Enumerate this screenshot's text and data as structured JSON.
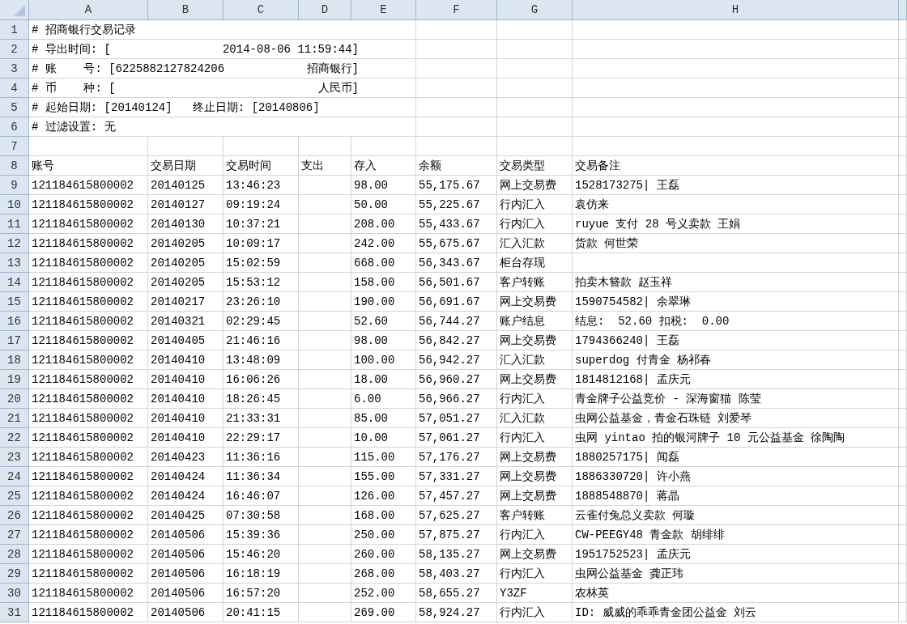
{
  "sheet": {
    "column_letters": [
      "A",
      "B",
      "C",
      "D",
      "E",
      "F",
      "G",
      "H"
    ],
    "row_numbers": [
      "1",
      "2",
      "3",
      "4",
      "5",
      "6",
      "7",
      "8",
      "9",
      "10",
      "11",
      "12",
      "13",
      "14",
      "15",
      "16",
      "17",
      "18",
      "19",
      "20",
      "21",
      "22",
      "23",
      "24",
      "25",
      "26",
      "27",
      "28",
      "29",
      "30",
      "31"
    ],
    "info_rows": [
      {
        "left": "# 招商银行交易记录"
      },
      {
        "left": "# 导出时间: [",
        "right": "2014-08-06 11:59:44]"
      },
      {
        "left": "# 账    号: [6225882127824206",
        "right": "招商银行]"
      },
      {
        "left": "# 币    种: [",
        "right": "人民币]"
      },
      {
        "left": "# 起始日期: [20140124]   终止日期: [20140806]"
      },
      {
        "left": "# 过滤设置: 无"
      }
    ],
    "table": {
      "columns": [
        "账号",
        "交易日期",
        "交易时间",
        "支出",
        "存入",
        "余额",
        "交易类型",
        "交易备注"
      ],
      "rows": [
        {
          "account": "121184615800002",
          "date": "20140125",
          "time": "13:46:23",
          "deposit": "98.00",
          "balance": "55,175.67",
          "type": "网上交易费",
          "note": "1528173275| 王磊"
        },
        {
          "account": "121184615800002",
          "date": "20140127",
          "time": "09:19:24",
          "deposit": "50.00",
          "balance": "55,225.67",
          "type": "行内汇入",
          "note": "袁仿来"
        },
        {
          "account": "121184615800002",
          "date": "20140130",
          "time": "10:37:21",
          "deposit": "208.00",
          "balance": "55,433.67",
          "type": "行内汇入",
          "note": "ruyue 支付 28 号义卖款 王娟"
        },
        {
          "account": "121184615800002",
          "date": "20140205",
          "time": "10:09:17",
          "deposit": "242.00",
          "balance": "55,675.67",
          "type": "汇入汇款",
          "note": "货款 何世荣"
        },
        {
          "account": "121184615800002",
          "date": "20140205",
          "time": "15:02:59",
          "deposit": "668.00",
          "balance": "56,343.67",
          "type": "柜台存现"
        },
        {
          "account": "121184615800002",
          "date": "20140205",
          "time": "15:53:12",
          "deposit": "158.00",
          "balance": "56,501.67",
          "type": "客户转账",
          "note": "拍卖木簪款 赵玉祥"
        },
        {
          "account": "121184615800002",
          "date": "20140217",
          "time": "23:26:10",
          "deposit": "190.00",
          "balance": "56,691.67",
          "type": "网上交易费",
          "note": "1590754582| 余翠琳"
        },
        {
          "account": "121184615800002",
          "date": "20140321",
          "time": "02:29:45",
          "deposit": "52.60",
          "balance": "56,744.27",
          "type": "账户结息",
          "note": "结息:  52.60 扣税:  0.00"
        },
        {
          "account": "121184615800002",
          "date": "20140405",
          "time": "21:46:16",
          "deposit": "98.00",
          "balance": "56,842.27",
          "type": "网上交易费",
          "note": "1794366240| 王磊"
        },
        {
          "account": "121184615800002",
          "date": "20140410",
          "time": "13:48:09",
          "deposit": "100.00",
          "balance": "56,942.27",
          "type": "汇入汇款",
          "note": "superdog 付青金 杨祁春"
        },
        {
          "account": "121184615800002",
          "date": "20140410",
          "time": "16:06:26",
          "deposit": "18.00",
          "balance": "56,960.27",
          "type": "网上交易费",
          "note": "1814812168| 孟庆元"
        },
        {
          "account": "121184615800002",
          "date": "20140410",
          "time": "18:26:45",
          "deposit": "6.00",
          "balance": "56,966.27",
          "type": "行内汇入",
          "note": "青金牌子公益竞价 - 深海窗猫 陈莹"
        },
        {
          "account": "121184615800002",
          "date": "20140410",
          "time": "21:33:31",
          "deposit": "85.00",
          "balance": "57,051.27",
          "type": "汇入汇款",
          "note": "虫网公益基金，青金石珠链 刘爱琴"
        },
        {
          "account": "121184615800002",
          "date": "20140410",
          "time": "22:29:17",
          "deposit": "10.00",
          "balance": "57,061.27",
          "type": "行内汇入",
          "note": "虫网 yintao 拍的银河牌子 10 元公益基金 徐陶陶"
        },
        {
          "account": "121184615800002",
          "date": "20140423",
          "time": "11:36:16",
          "deposit": "115.00",
          "balance": "57,176.27",
          "type": "网上交易费",
          "note": "1880257175| 闻磊"
        },
        {
          "account": "121184615800002",
          "date": "20140424",
          "time": "11:36:34",
          "deposit": "155.00",
          "balance": "57,331.27",
          "type": "网上交易费",
          "note": "1886330720| 许小燕"
        },
        {
          "account": "121184615800002",
          "date": "20140424",
          "time": "16:46:07",
          "deposit": "126.00",
          "balance": "57,457.27",
          "type": "网上交易费",
          "note": "1888548870| 蒋晶"
        },
        {
          "account": "121184615800002",
          "date": "20140425",
          "time": "07:30:58",
          "deposit": "168.00",
          "balance": "57,625.27",
          "type": "客户转账",
          "note": "云雀付兔总义卖款 何璇"
        },
        {
          "account": "121184615800002",
          "date": "20140506",
          "time": "15:39:36",
          "deposit": "250.00",
          "balance": "57,875.27",
          "type": "行内汇入",
          "note": "CW-PEEGY48 青金款 胡绯绯"
        },
        {
          "account": "121184615800002",
          "date": "20140506",
          "time": "15:46:20",
          "deposit": "260.00",
          "balance": "58,135.27",
          "type": "网上交易费",
          "note": "1951752523| 孟庆元"
        },
        {
          "account": "121184615800002",
          "date": "20140506",
          "time": "16:18:19",
          "deposit": "268.00",
          "balance": "58,403.27",
          "type": "行内汇入",
          "note": "虫网公益基金 龚正玮"
        },
        {
          "account": "121184615800002",
          "date": "20140506",
          "time": "16:57:20",
          "deposit": "252.00",
          "balance": "58,655.27",
          "type": "Y3ZF",
          "note": "农林英"
        },
        {
          "account": "121184615800002",
          "date": "20140506",
          "time": "20:41:15",
          "deposit": "269.00",
          "balance": "58,924.27",
          "type": "行内汇入",
          "note": "ID: 威威的乖乖青金团公益金 刘云"
        }
      ]
    }
  }
}
